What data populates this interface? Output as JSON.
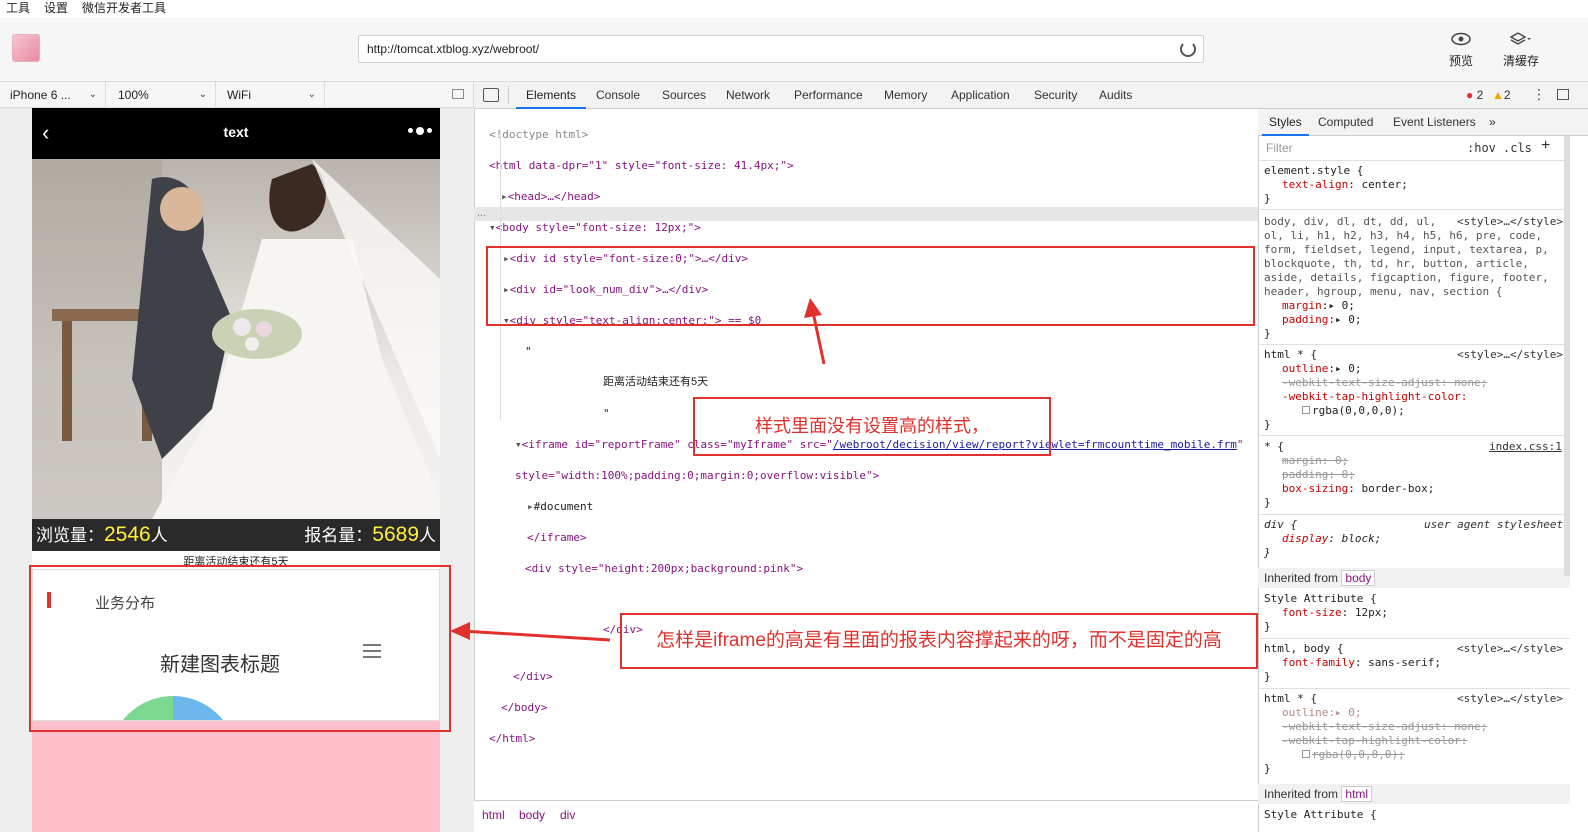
{
  "menu": [
    "工具",
    "设置",
    "微信开发者工具"
  ],
  "url": "http://tomcat.xtblog.xyz/webroot/",
  "top_buttons": {
    "preview": "预览",
    "clear_cache": "清缓存"
  },
  "device": {
    "model": "iPhone 6 ...",
    "zoom": "100%",
    "network": "WiFi"
  },
  "phone": {
    "nav_title": "text",
    "views_label": "浏览量：",
    "views_count": "2546",
    "views_unit": "人",
    "signup_label": "报名量：",
    "signup_count": "5689",
    "signup_unit": "人",
    "countdown": "距离活动结束还有5天",
    "section_title": "业务分布",
    "chart_title": "新建图表标题"
  },
  "devtools": {
    "tabs": [
      "Elements",
      "Console",
      "Sources",
      "Network",
      "Performance",
      "Memory",
      "Application",
      "Security",
      "Audits"
    ],
    "errors": "2",
    "warnings": "2",
    "code": {
      "doctype": "<!doctype html>",
      "html_open": "<html data-dpr=\"1\" style=\"font-size: 41.4px;\">",
      "head": "<head>…</head>",
      "body_open": "<body style=\"font-size: 12px;\">",
      "div1": "<div id style=\"font-size:0;\">…</div>",
      "div2": "<div id=\"look_num_div\">…</div>",
      "div3": "<div style=\"text-align:center;\"> == $0",
      "quote": "\"",
      "countdown_text": "距离活动结束还有5天",
      "quote2": "\"",
      "iframe_open_a": "<iframe id=\"reportFrame\" class=\"myIframe\" src=\"",
      "iframe_src": "/webroot/decision/view/report?viewlet=frmcounttime_mobile.frm",
      "iframe_open_b": "\"",
      "iframe_style": "style=\"width:100%;padding:0;margin:0;overflow:visible\">",
      "document": "#document",
      "iframe_close": "</iframe>",
      "div_pink": "<div style=\"height:200px;background:pink\">",
      "div_close_inner": "</div>",
      "div_close": "</div>",
      "body_close": "</body>",
      "html_close": "</html>",
      "dots": "..."
    },
    "breadcrumbs": [
      "html",
      "body",
      "div"
    ]
  },
  "styles_panel": {
    "tabs": [
      "Styles",
      "Computed",
      "Event Listeners",
      "»"
    ],
    "filter_placeholder": "Filter",
    "hov": ":hov",
    "cls": ".cls",
    "plus": "+",
    "rules": {
      "element_style": "element.style {",
      "element_prop": "text-align",
      "element_val": "center;",
      "reset_selector": "body, div, dl, dt, dd, ul,\nol, li, h1, h2, h3, h4, h5, h6, pre, code,\nform, fieldset, legend, input, textarea, p,\nblockquote, th, td, hr, button, article,\naside, details, figcaption, figure, footer,\nheader, hgroup, menu, nav, section {",
      "reset_src": "<style>…</style>",
      "margin": "margin",
      "padding": "padding",
      "zero": "0;",
      "html_star": "html * {",
      "outline": "outline",
      "wtsa": "-webkit-text-size-adjust: none;",
      "wthc": "-webkit-tap-highlight-color:",
      "rgba": "rgba(0,0,0,0);",
      "star": "* {",
      "star_src": "index.css:1",
      "margin_zero_struck": "margin: 0;",
      "padding_zero_struck": "padding: 0;",
      "box_sizing": "box-sizing",
      "border_box": "border-box;",
      "div_rule": "div {",
      "ua": "user agent stylesheet",
      "display": "display",
      "block": "block;",
      "inherited_from": "Inherited from",
      "body_tag": "body",
      "style_attr": "Style Attribute {",
      "font_size": "font-size",
      "px12": "12px;",
      "html_body": "html, body {",
      "font_family": "font-family",
      "sans": "sans-serif;",
      "html_tag": "html",
      "close": "}",
      "wthc_struck": "-webkit-tap-highlight-color:",
      "rgba_struck": "rgba(0,0,0,0);"
    }
  },
  "annotations": {
    "note1": "样式里面没有设置高的样式，",
    "note2": "怎样是iframe的高是有里面的报表内容撑起来的呀，而不是固定的高"
  },
  "colors": {
    "accent_red": "#e0312d",
    "stat_yellow": "#ffef3a",
    "pink": "#ffc0cb",
    "tab_blue": "#1a73e8"
  }
}
